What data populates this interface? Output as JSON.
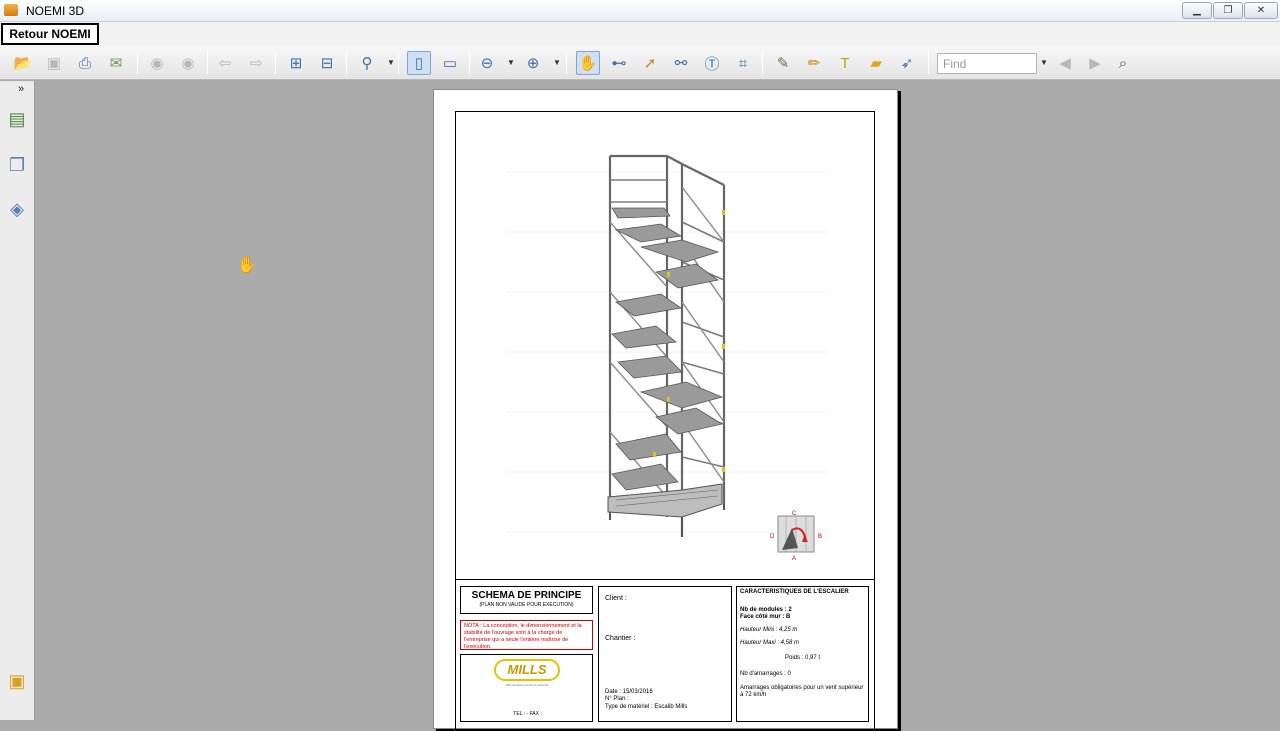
{
  "window": {
    "title": "NOEMI 3D",
    "min": "▁",
    "max": "❐",
    "close": "✕"
  },
  "retour_button": "Retour NOEMI",
  "toolbar": {
    "find_placeholder": "Find",
    "icons": [
      "open-icon",
      "save-icon",
      "print-icon",
      "email-icon",
      "prev-page-icon",
      "next-page-icon",
      "back-icon",
      "forward-icon",
      "fit-page-icon",
      "fit-width-icon",
      "zoom-icon",
      "single-page-icon",
      "continuous-page-icon",
      "zoom-out-icon",
      "zoom-in-icon",
      "hand-tool-icon",
      "reading-mode-icon",
      "select-icon",
      "binoculars-icon",
      "text-select-icon",
      "snapshot-icon",
      "stamp-icon",
      "highlight-icon",
      "typewriter-icon",
      "comment-icon",
      "arrow-icon",
      "find-prev-icon",
      "find-next-icon",
      "search-icon"
    ]
  },
  "document": {
    "schema_title": "SCHEMA DE PRINCIPE",
    "schema_subtitle": "(PLAN NON VALIDE POUR EXECUTION)",
    "nota": "NOTA : La conception, le dimensionnement et la stabilité de l'ouvrage sont à la charge de l'entreprise qui a seule l'entière maîtrise de l'exécution.",
    "logo_text": "MILLS",
    "logo_tagline": "Mills Solutions Accès & Sécurité",
    "tel_fax": "TEL : - FAX :",
    "client_label": "Client :",
    "chantier_label": "Chantier :",
    "date_line": "Date : 15/03/2016",
    "plan_line": "N° Plan :",
    "type_line": "Type de matériel : Escalib Mills",
    "carac_title": "CARACTERISTIQUES DE L'ESCALIER",
    "nb_modules": "Nb de modules : 2",
    "face_cote_mur": "Face côté mur : B",
    "hauteur_mini": "Hauteur Mini : 4,25 m",
    "hauteur_maxi": "Hauteur Maxi : 4,58 m",
    "poids": "Poids : 0,97 t",
    "nb_amarrages": "Nb d'amarrages : 0",
    "amarrages_text": "Amarrages obligatoires pour un vent supérieur à 72 km/h",
    "compass": {
      "c": "C",
      "a": "A",
      "b": "B",
      "d": "D"
    }
  }
}
